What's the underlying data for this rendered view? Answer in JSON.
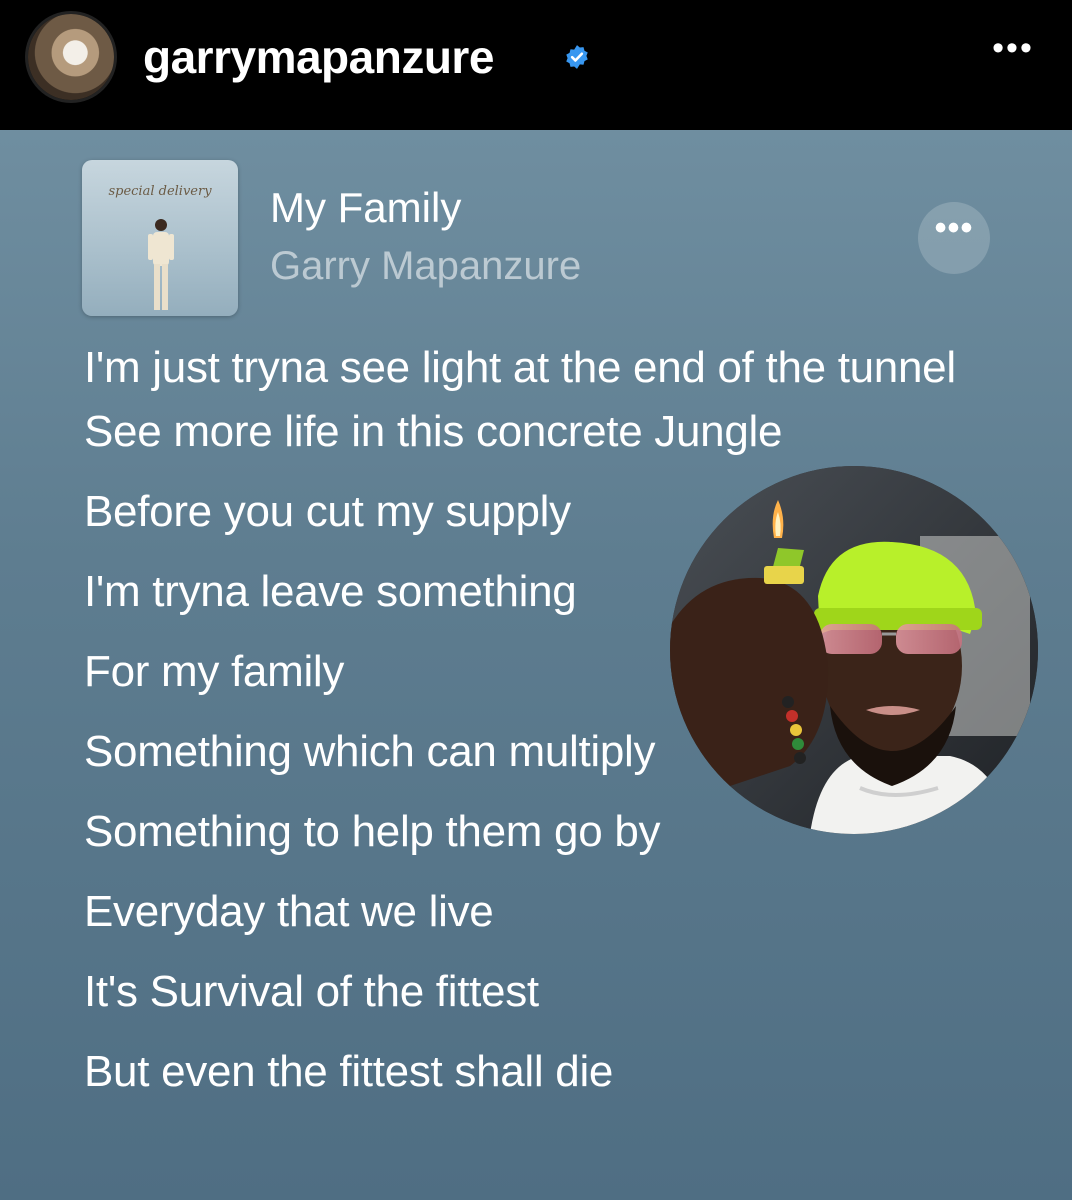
{
  "header": {
    "username": "garrymapanzure",
    "verified_icon": "verified-badge-icon",
    "more_icon": "more-horizontal-icon",
    "more_label": "•••"
  },
  "song": {
    "title": "My Family",
    "artist": "Garry Mapanzure",
    "cover_text": "special delivery",
    "more_label": "•••"
  },
  "lyrics": [
    "I'm just tryna see light at the end of the tunnel See more life in this concrete Jungle",
    "Before you cut my supply",
    "I'm tryna leave something",
    "For my family",
    "Something which can multiply",
    "Something to help them go by",
    "Everyday that we live",
    "It's Survival of the fittest",
    "But even the fittest shall die"
  ],
  "colors": {
    "header_bg": "#000000",
    "card_bg": "#5e7d90",
    "verified": "#3897f0",
    "beanie": "#b8f02a"
  }
}
